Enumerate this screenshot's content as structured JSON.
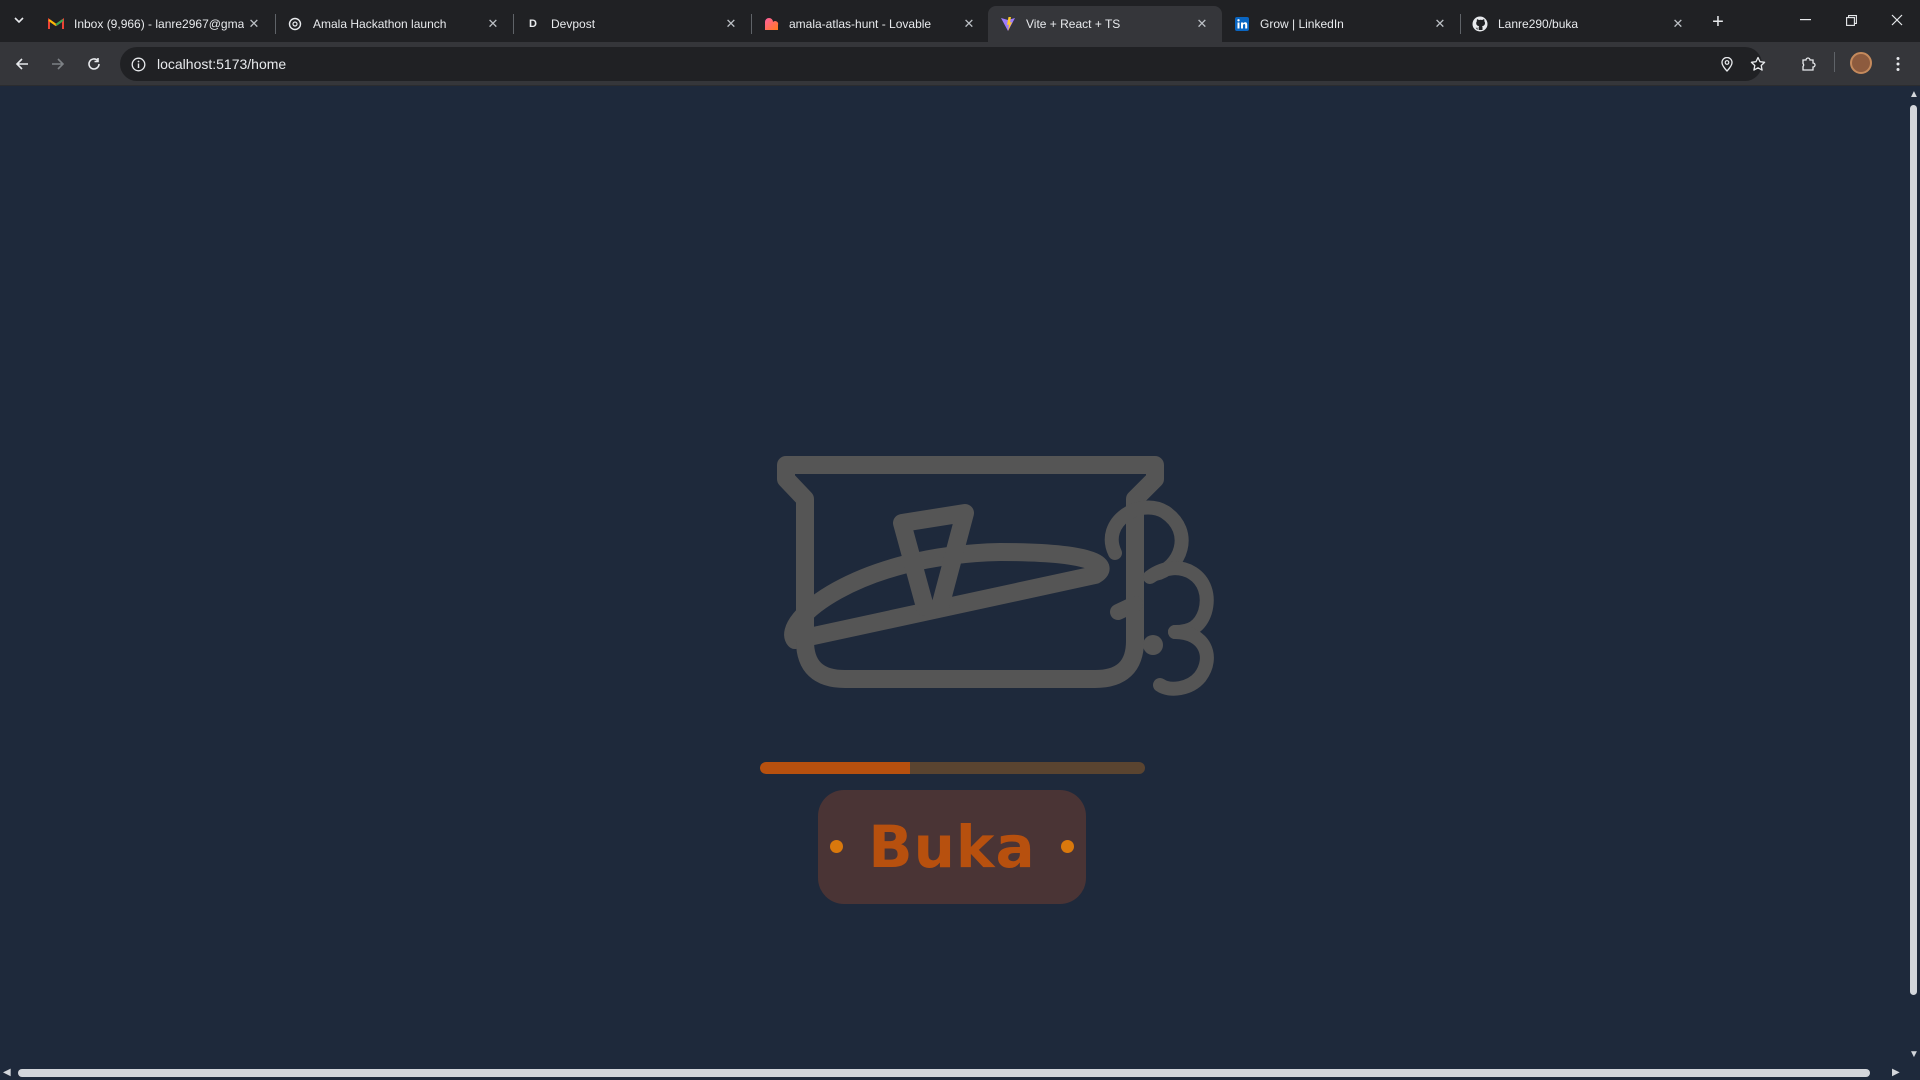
{
  "browser": {
    "tabs": [
      {
        "title": "Inbox (9,966) - lanre2967@gma",
        "icon": "gmail-icon",
        "active": false
      },
      {
        "title": "Amala Hackathon launch",
        "icon": "openai-icon",
        "active": false
      },
      {
        "title": "Devpost",
        "icon": "devpost-icon",
        "active": false
      },
      {
        "title": "amala-atlas-hunt - Lovable",
        "icon": "lovable-icon",
        "active": false
      },
      {
        "title": "Vite + React + TS",
        "icon": "vite-icon",
        "active": true
      },
      {
        "title": "Grow | LinkedIn",
        "icon": "linkedin-icon",
        "active": false
      },
      {
        "title": "Lanre290/buka",
        "icon": "github-icon",
        "active": false
      }
    ],
    "url": "localhost:5173/home"
  },
  "page": {
    "brand": "Buka",
    "loading_progress": 0.39,
    "colors": {
      "background": "#1e293b",
      "pot_stroke": "#555555",
      "accent": "#b7500e",
      "dot": "#d9780c",
      "plate": "#4a3435"
    }
  }
}
